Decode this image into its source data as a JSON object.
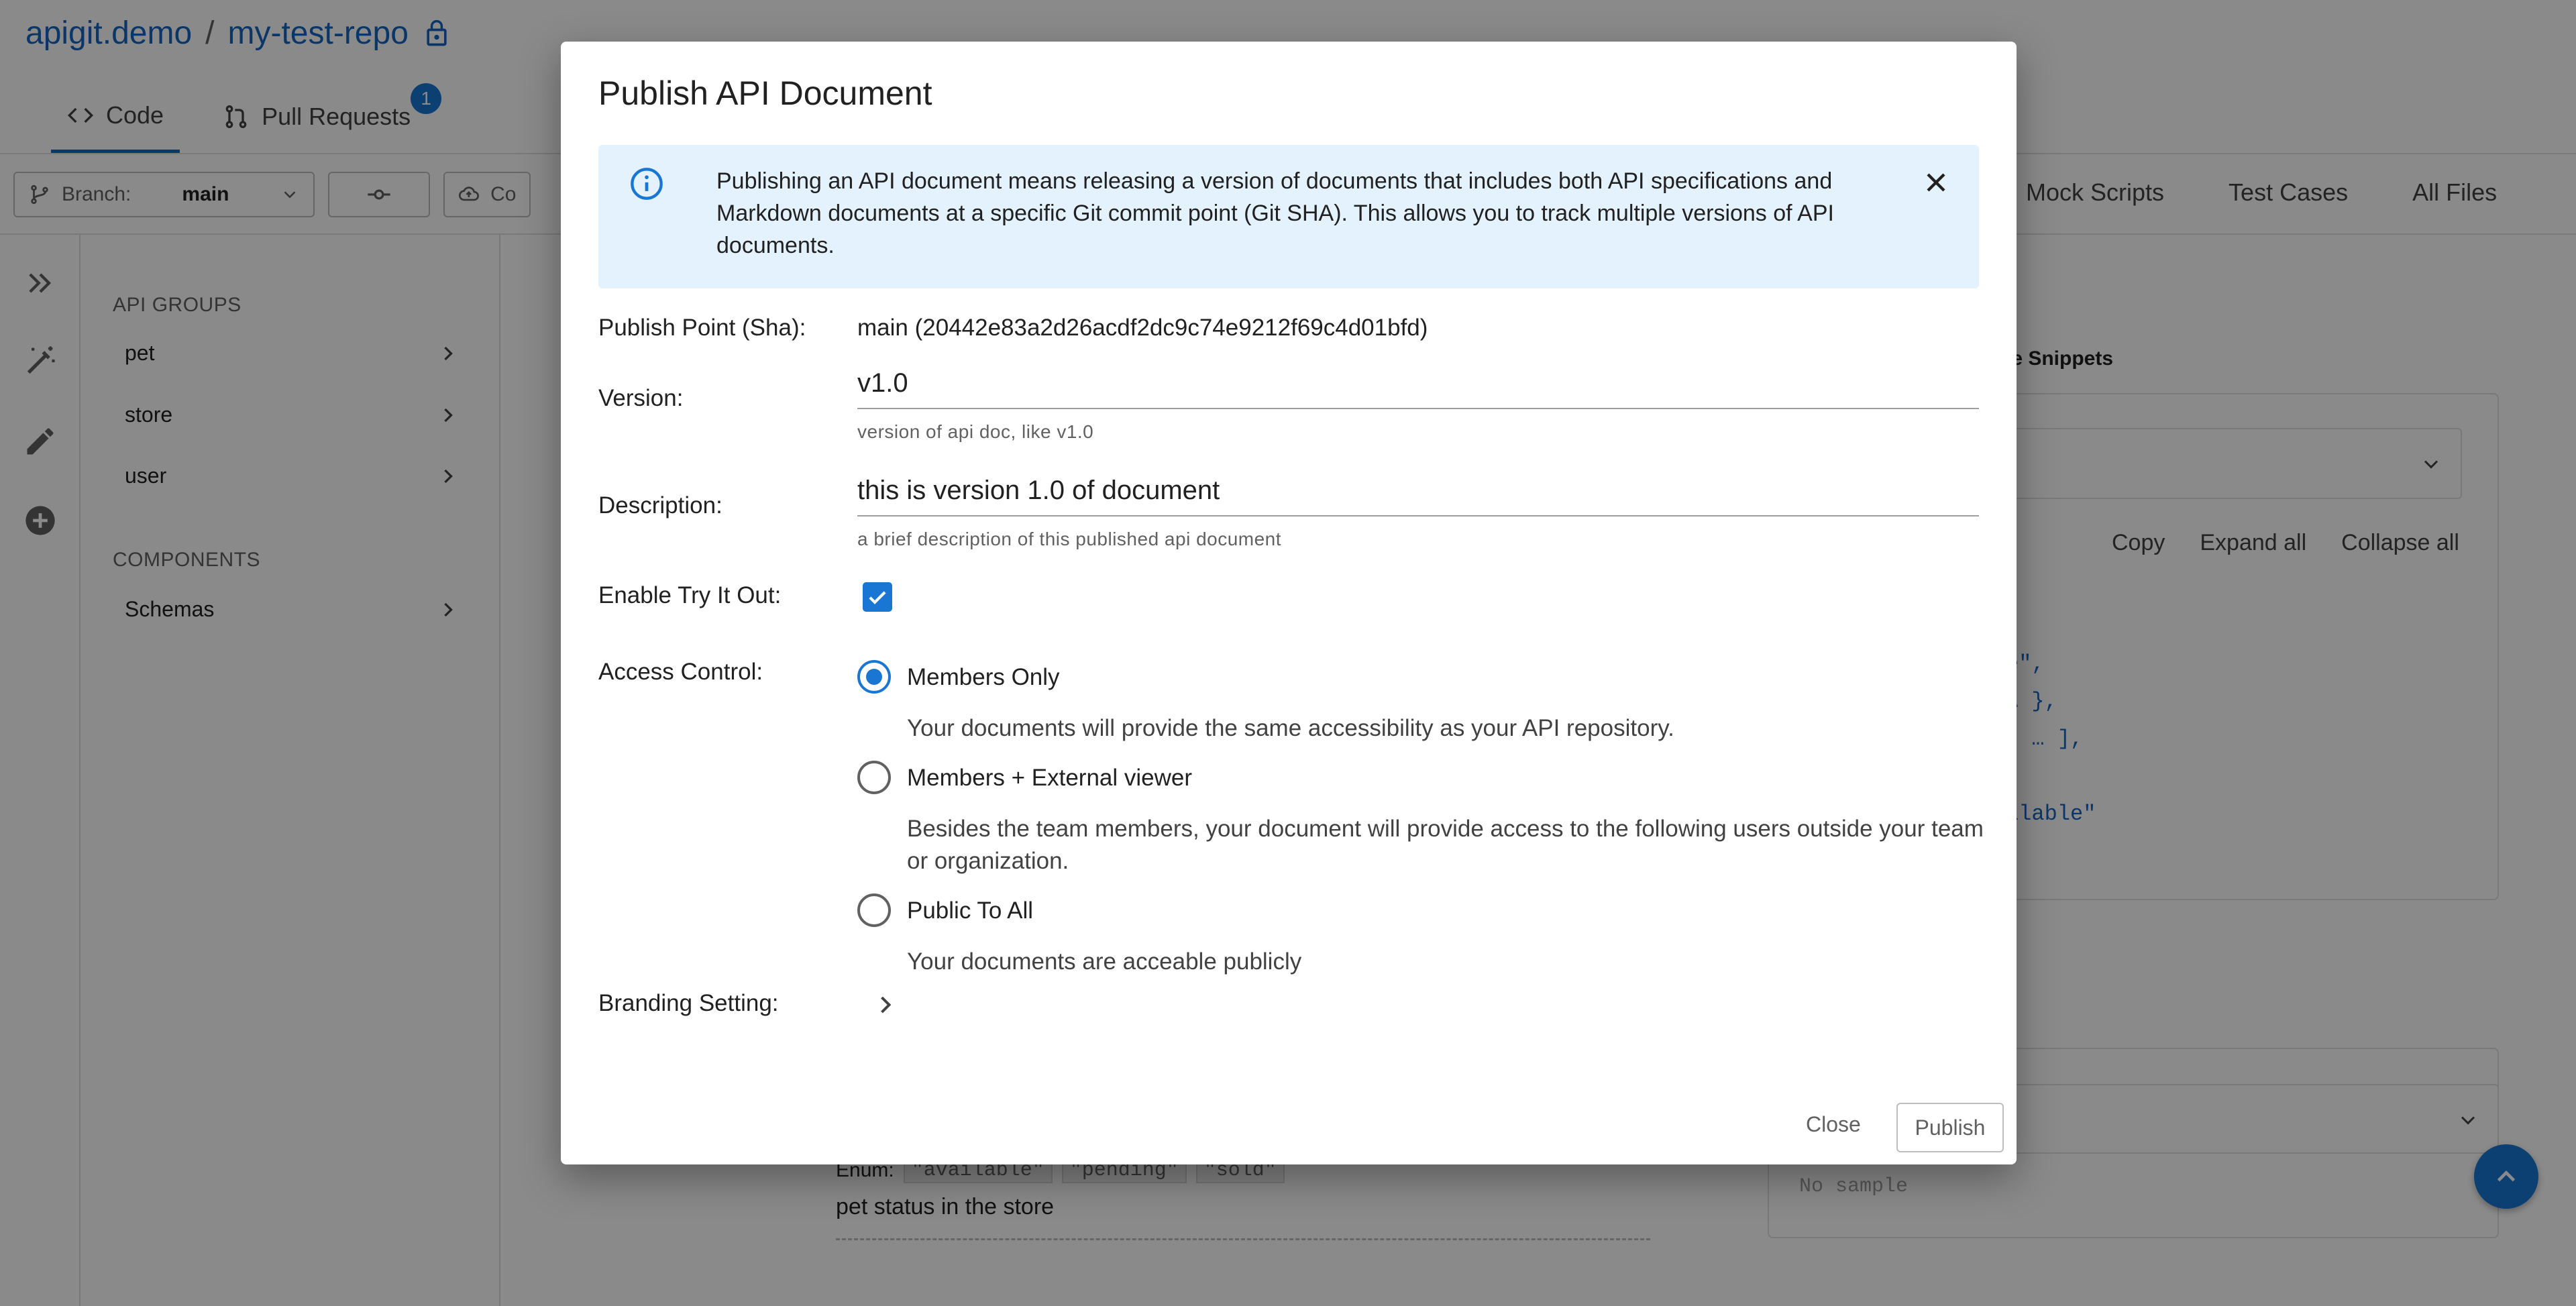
{
  "repo": {
    "org": "apigit.demo",
    "separator": "/",
    "name": "my-test-repo"
  },
  "tabs": [
    {
      "label": "Code"
    },
    {
      "label": "Pull Requests",
      "badge": "1"
    }
  ],
  "toolbar": {
    "branch_label": "Branch:",
    "branch_value": "main",
    "third_label": "Co"
  },
  "right_tabs": [
    "Mock Scripts",
    "Test Cases",
    "All Files"
  ],
  "sidebar": {
    "groups_header": "API GROUPS",
    "groups": [
      "pet",
      "store",
      "user"
    ],
    "components_header": "COMPONENTS",
    "components": [
      "Schemas"
    ]
  },
  "background": {
    "snippets_label": "de Snippets",
    "copy": "Copy",
    "expand_all": "Expand all",
    "collapse_all": "Collapse all",
    "code_lines": [
      "e\",",
      "… },",
      "[ … ],",
      ",",
      "ilable\""
    ],
    "enum_label": "Enum:",
    "enum_values": [
      "\"available\"",
      "\"pending\"",
      "\"sold\""
    ],
    "pet_status": "pet status in the store",
    "no_sample": "No sample"
  },
  "dialog": {
    "title": "Publish API Document",
    "alert_text": "Publishing an API document means releasing a version of documents that includes both API specifications and Markdown documents at a specific Git commit point (Git SHA). This allows you to track multiple versions of API documents.",
    "publish_point_label": "Publish Point (Sha):",
    "publish_point_value": "main  (20442e83a2d26acdf2dc9c74e9212f69c4d01bfd)",
    "version_label": "Version:",
    "version_value": "v1.0",
    "version_helper": "version of api doc, like v1.0",
    "description_label": "Description:",
    "description_value": "this is version 1.0 of document",
    "description_helper": "a brief description of this published api document",
    "try_it_label": "Enable Try It Out:",
    "try_it_checked": true,
    "access_label": "Access Control:",
    "access_options": [
      {
        "label": "Members Only",
        "desc": "Your documents will provide the same accessibility as your API repository.",
        "selected": true
      },
      {
        "label": "Members + External viewer",
        "desc": "Besides the team members, your document will provide access to the following users outside your team or organization.",
        "selected": false
      },
      {
        "label": "Public To All",
        "desc": "Your documents are acceable publicly",
        "selected": false
      }
    ],
    "branding_label": "Branding Setting:",
    "close_label": "Close",
    "publish_label": "Publish"
  },
  "colors": {
    "accent": "#1976d2",
    "link": "#1565c0",
    "alert_bg": "#e3f2fd",
    "scrim": "rgba(0,0,0,0.46)"
  },
  "icons": [
    "lock-icon",
    "code-icon",
    "pull-request-icon",
    "branch-icon",
    "commit-icon",
    "cloud-icon",
    "expand-icon",
    "magic-wand-icon",
    "pencil-icon",
    "add-circle-icon",
    "chevron-right-icon",
    "chevron-down-icon",
    "info-icon",
    "close-icon",
    "check-icon",
    "arrow-up-icon"
  ]
}
